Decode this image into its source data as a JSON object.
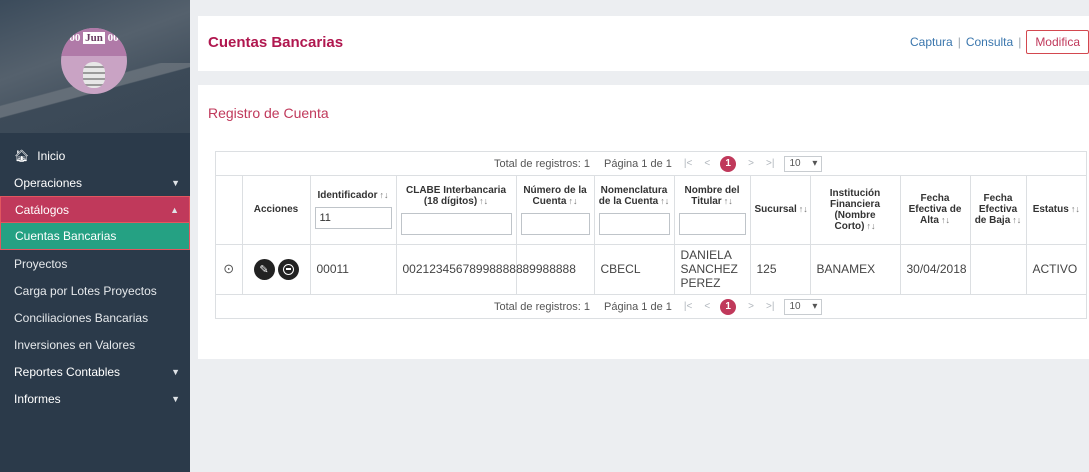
{
  "avatar": {
    "label_left": "00",
    "label_mid": "Jun",
    "label_right": "00"
  },
  "sidebar": {
    "items": [
      {
        "label": "Inicio"
      },
      {
        "label": "Operaciones"
      },
      {
        "label": "Catálogos"
      },
      {
        "label": "Cuentas Bancarias"
      },
      {
        "label": "Proyectos"
      },
      {
        "label": "Carga por Lotes Proyectos"
      },
      {
        "label": "Conciliaciones Bancarias"
      },
      {
        "label": "Inversiones en Valores"
      },
      {
        "label": "Reportes Contables"
      },
      {
        "label": "Informes"
      }
    ]
  },
  "header": {
    "title": "Cuentas Bancarias",
    "links": {
      "captura": "Captura",
      "consulta": "Consulta",
      "modifica": "Modifica"
    }
  },
  "panel": {
    "title": "Registro de Cuenta"
  },
  "pager": {
    "total": "Total de registros: 1",
    "page": "Página 1 de 1",
    "current": "1",
    "page_size": "10"
  },
  "table": {
    "headers": {
      "acciones": "Acciones",
      "identificador": "Identificador",
      "clabe": "CLABE Interbancaria (18 dígitos)",
      "numero": "Número de la Cuenta",
      "nomenclatura": "Nomenclatura de la Cuenta",
      "titular": "Nombre del Titular",
      "sucursal": "Sucursal",
      "institucion": "Institución Financiera (Nombre Corto)",
      "fecha_alta": "Fecha Efectiva de Alta",
      "fecha_baja": "Fecha Efectiva de Baja",
      "estatus": "Estatus"
    },
    "filters": {
      "identificador": "11"
    },
    "row": {
      "identificador": "00011",
      "clabe": "002123456789988888",
      "numero": "89988888",
      "nomenclatura": "CBECL",
      "titular": "DANIELA SANCHEZ PEREZ",
      "sucursal": "125",
      "institucion": "BANAMEX",
      "fecha_alta": "30/04/2018",
      "fecha_baja": "",
      "estatus": "ACTIVO"
    }
  },
  "icons": {
    "home": "home-icon",
    "chevron_down": "chevron-down-icon",
    "chevron_up": "chevron-up-icon",
    "sort": "sort-icon",
    "expand": "expand-icon",
    "edit": "pencil-icon",
    "remove": "minus-circle-icon"
  }
}
